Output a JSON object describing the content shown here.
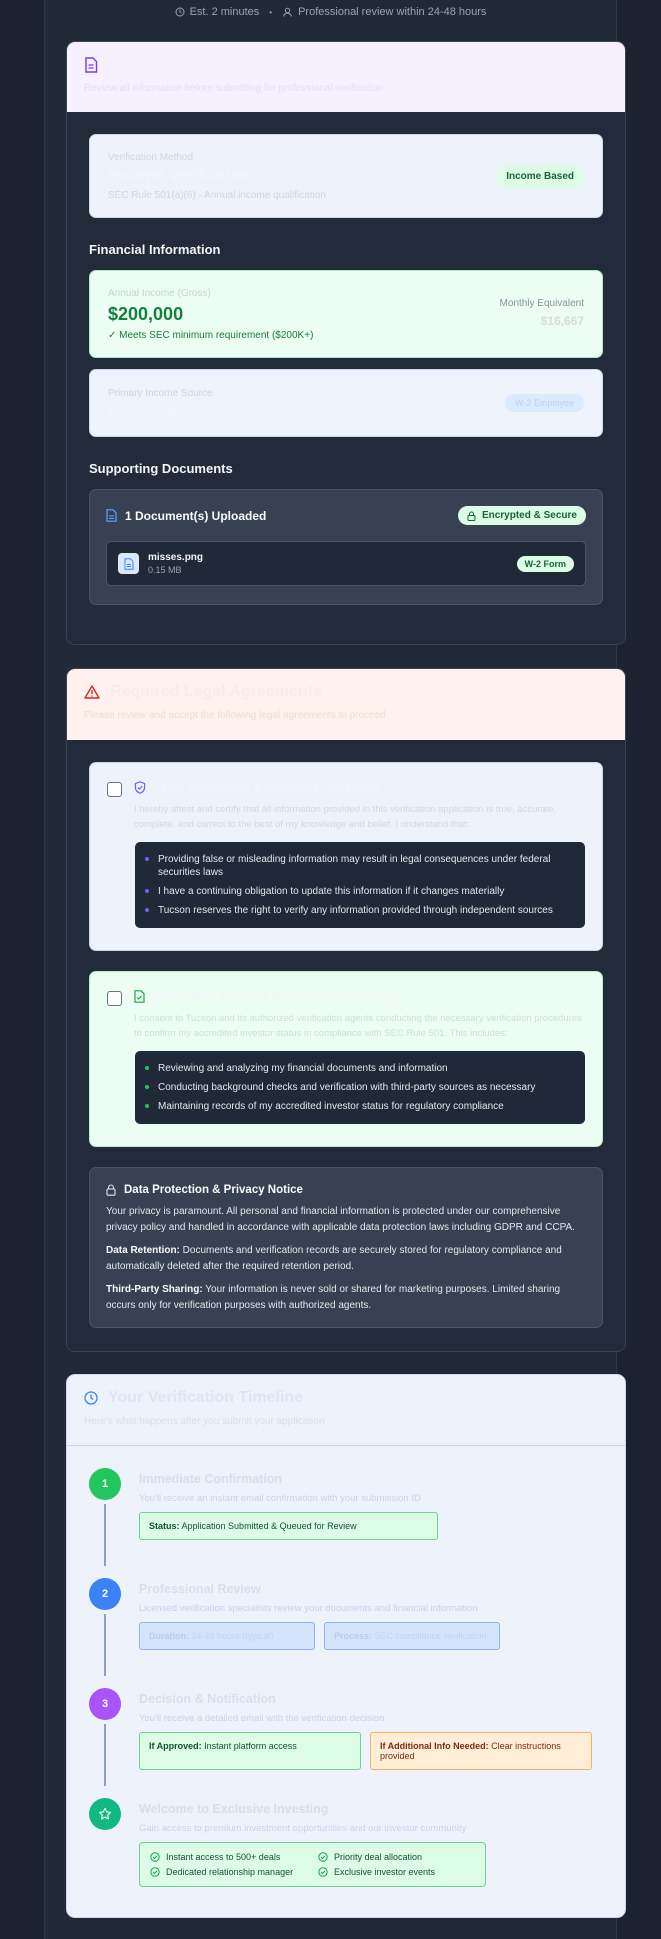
{
  "topbar": {
    "est_time": "Est. 2 minutes",
    "review": "Professional review within 24-48 hours"
  },
  "summary": {
    "title": "Complete Verification Summary",
    "subtitle": "Review all information before submitting for professional verification",
    "method": {
      "label": "Verification Method",
      "value": "Income Verification",
      "desc": "SEC Rule 501(a)(6) - Annual income qualification",
      "badge": "Income Based"
    },
    "financial_title": "Financial Information",
    "income": {
      "label": "Annual Income (Gross)",
      "amount": "$200,000",
      "meets": "✓ Meets SEC minimum requirement ($200K+)",
      "monthly_label": "Monthly Equivalent",
      "monthly_value": "$16,667"
    },
    "source": {
      "label": "Primary Income Source",
      "value": "Employment",
      "badge": "W-2 Employee"
    },
    "docs_title": "Supporting Documents",
    "docs": {
      "count_label": "1 Document(s) Uploaded",
      "secure": "Encrypted & Secure",
      "file_name": "misses.png",
      "file_size": "0.15 MB",
      "file_tag": "W-2 Form"
    }
  },
  "legal": {
    "title": "Required Legal Agreements",
    "subtitle": "Please review and accept the following legal agreements to proceed",
    "attestation": {
      "title": "Legal Attestation & Accuracy Statement",
      "text": "I hereby attest and certify that all information provided in this verification application is true, accurate, complete, and correct to the best of my knowledge and belief. I understand that:",
      "bullets": [
        "Providing false or misleading information may result in legal consequences under federal securities laws",
        "I have a continuing obligation to update this information if it changes materially",
        "Tucson reserves the right to verify any information provided through independent sources"
      ]
    },
    "consent": {
      "title": "Verification Consent & Privacy Agreement",
      "text": "I consent to Tucson and its authorized verification agents conducting the necessary verification procedures to confirm my accredited investor status in compliance with SEC Rule 501. This includes:",
      "bullets": [
        "Reviewing and analyzing my financial documents and information",
        "Conducting background checks and verification with third-party sources as necessary",
        "Maintaining records of my accredited investor status for regulatory compliance"
      ]
    },
    "privacy": {
      "title": "Data Protection & Privacy Notice",
      "p1": "Your privacy is paramount. All personal and financial information is protected under our comprehensive privacy policy and handled in accordance with applicable data protection laws including GDPR and CCPA.",
      "p2_label": "Data Retention:",
      "p2": " Documents and verification records are securely stored for regulatory compliance and automatically deleted after the required retention period.",
      "p3_label": "Third-Party Sharing:",
      "p3": " Your information is never sold or shared for marketing purposes. Limited sharing occurs only for verification purposes with authorized agents."
    }
  },
  "timeline": {
    "title": "Your Verification Timeline",
    "subtitle": "Here's what happens after you submit your application",
    "steps": [
      {
        "num": "1",
        "title": "Immediate Confirmation",
        "desc": "You'll receive an instant email confirmation with your submission ID",
        "box1_label": "Status:",
        "box1_text": " Application Submitted & Queued for Review"
      },
      {
        "num": "2",
        "title": "Professional Review",
        "desc": "Licensed verification specialists review your documents and financial information",
        "box1_label": "Duration:",
        "box1_text": " 24-48 hours (typical)",
        "box2_label": "Process:",
        "box2_text": " SEC compliance verification"
      },
      {
        "num": "3",
        "title": "Decision & Notification",
        "desc": "You'll receive a detailed email with the verification decision",
        "box1_label": "If Approved:",
        "box1_text": " Instant platform access",
        "box2_label": "If Additional Info Needed:",
        "box2_text": " Clear instructions provided"
      },
      {
        "title": "Welcome to Exclusive Investing",
        "desc": "Gain access to premium investment opportunities and our investor community",
        "perks": [
          "Instant access to 500+ deals",
          "Priority deal allocation",
          "Dedicated relationship manager",
          "Exclusive investor events"
        ]
      }
    ]
  },
  "colors": {
    "green": "#22c55e",
    "blue": "#3b82f6",
    "purple": "#a855f7",
    "teal": "#10b981"
  }
}
